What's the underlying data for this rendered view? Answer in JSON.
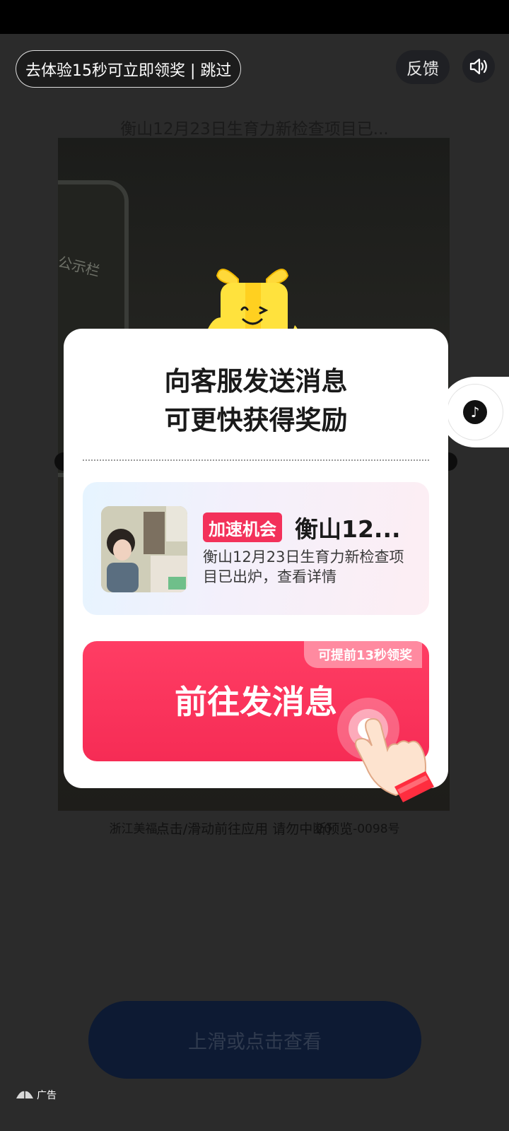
{
  "header": {
    "reward_pill": "去体验15秒可立即领奖 | 跳过",
    "feedback": "反馈",
    "sound_icon": "speaker-icon"
  },
  "video": {
    "title": "衡山12月23日生育力新检查项目已...",
    "board_text": "公示栏",
    "caption": "浙江美福",
    "caption_tail": "20",
    "caption_end": "-0098号",
    "swipe_hint": "点击/滑动前往应用 请勿中断预览"
  },
  "side_tab": {
    "icon": "douyin-icon"
  },
  "modal": {
    "title_line1": "向客服发送消息",
    "title_line2": "可更快获得奖励",
    "card": {
      "badge": "加速机会",
      "headline": "衡山12...",
      "description": "衡山12月23日生育力新检查项目已出炉，查看详情"
    },
    "button": {
      "label": "前往发消息",
      "tag": "可提前13秒领奖"
    }
  },
  "bottom": {
    "cta": "上滑或点击查看",
    "ad_label": "广告"
  },
  "colors": {
    "accent": "#f62c55",
    "badge": "#f3315a",
    "cta_bg": "#0d1a33"
  }
}
